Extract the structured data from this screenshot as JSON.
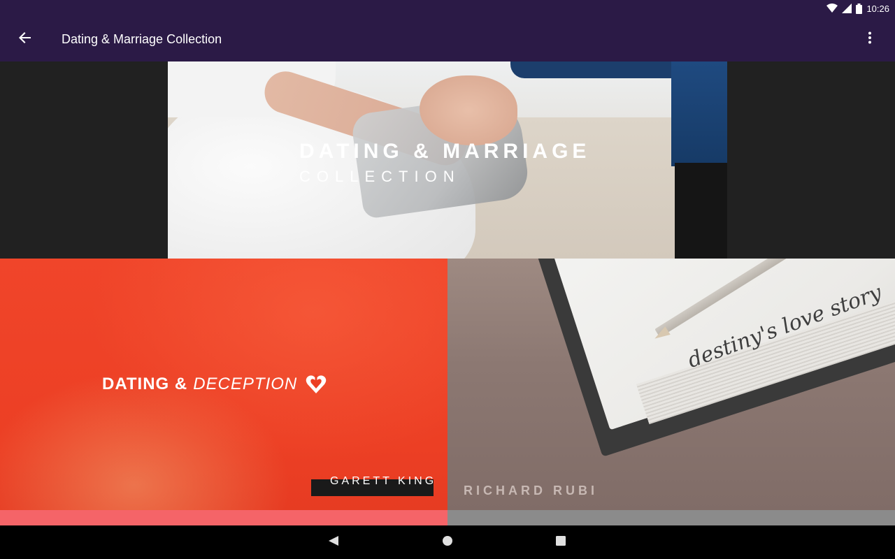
{
  "status_bar": {
    "time": "10:26",
    "icons": [
      "wifi-icon",
      "signal-icon",
      "battery-icon"
    ]
  },
  "app_bar": {
    "title": "Dating & Marriage Collection",
    "back_icon": "arrow-back-icon",
    "overflow_icon": "more-vert-icon",
    "background": "#2b1a46"
  },
  "hero": {
    "title": "DATING & MARRIAGE",
    "subtitle": "COLLECTION"
  },
  "series": [
    {
      "title_bold": "DATING &",
      "title_italic": "DECEPTION",
      "speaker": "GARETT KING",
      "accent": "#f56468",
      "background": "#ec3f24"
    },
    {
      "script_text": "destiny's love story",
      "speaker": "RICHARD RUBI",
      "accent": "#8b8b8b"
    }
  ],
  "nav_bar": {
    "buttons": [
      "nav-back-icon",
      "nav-home-icon",
      "nav-recents-icon"
    ]
  }
}
